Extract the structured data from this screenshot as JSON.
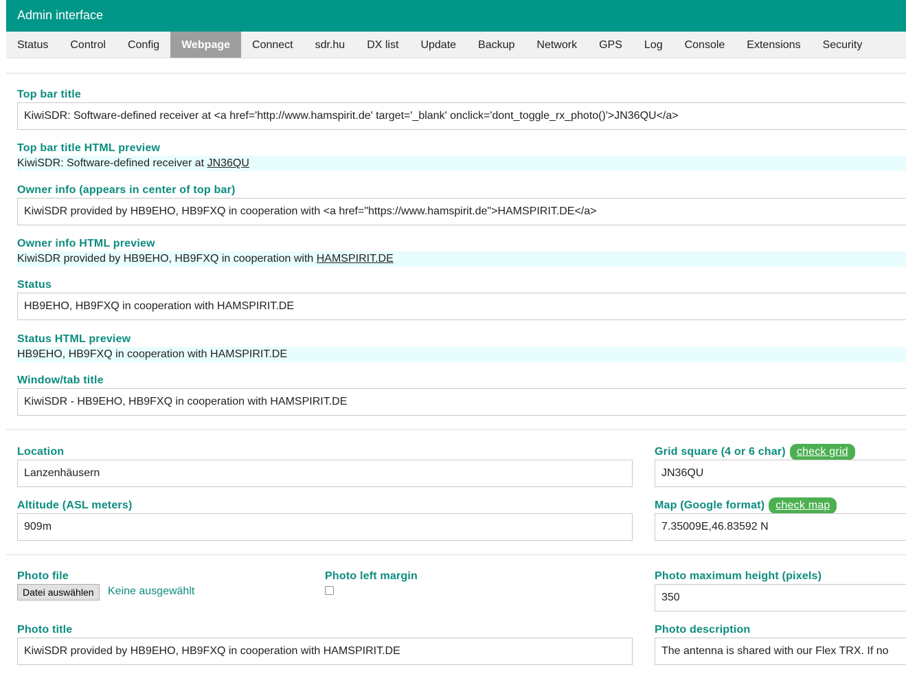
{
  "header": {
    "title": "Admin interface"
  },
  "tabs": [
    {
      "label": "Status"
    },
    {
      "label": "Control"
    },
    {
      "label": "Config"
    },
    {
      "label": "Webpage",
      "active": true
    },
    {
      "label": "Connect"
    },
    {
      "label": "sdr.hu"
    },
    {
      "label": "DX list"
    },
    {
      "label": "Update"
    },
    {
      "label": "Backup"
    },
    {
      "label": "Network"
    },
    {
      "label": "GPS"
    },
    {
      "label": "Log"
    },
    {
      "label": "Console"
    },
    {
      "label": "Extensions"
    },
    {
      "label": "Security"
    }
  ],
  "top_bar_title": {
    "label": "Top bar title",
    "value": "KiwiSDR: Software-defined receiver at <a href='http://www.hamspirit.de' target='_blank' onclick='dont_toggle_rx_photo()'>JN36QU</a>",
    "preview_label": "Top bar title HTML preview",
    "preview_text": "KiwiSDR: Software-defined receiver at ",
    "preview_link": "JN36QU"
  },
  "owner_info": {
    "label": "Owner info (appears in center of top bar)",
    "value": "KiwiSDR provided by HB9EHO, HB9FXQ in cooperation with <a href=\"https://www.hamspirit.de\">HAMSPIRIT.DE</a>",
    "preview_label": "Owner info HTML preview",
    "preview_text": "KiwiSDR provided by HB9EHO, HB9FXQ in cooperation with ",
    "preview_link": "HAMSPIRIT.DE"
  },
  "status": {
    "label": "Status",
    "value": "HB9EHO, HB9FXQ in cooperation with HAMSPIRIT.DE",
    "preview_label": "Status HTML preview",
    "preview_text": "HB9EHO, HB9FXQ in cooperation with HAMSPIRIT.DE"
  },
  "window_title": {
    "label": "Window/tab title",
    "value": "KiwiSDR - HB9EHO, HB9FXQ in cooperation with HAMSPIRIT.DE"
  },
  "location": {
    "label": "Location",
    "value": "Lanzenhäusern"
  },
  "grid": {
    "label": "Grid square (4 or 6 char)",
    "button": "check grid",
    "value": "JN36QU"
  },
  "altitude": {
    "label": "Altitude (ASL meters)",
    "value": "909m"
  },
  "map": {
    "label": "Map (Google format)",
    "button": "check map",
    "value": "7.35009E,46.83592 N"
  },
  "photo_file": {
    "label": "Photo file",
    "button": "Datei auswählen",
    "status": "Keine ausgewählt"
  },
  "photo_left_margin": {
    "label": "Photo left margin",
    "checked": false
  },
  "photo_max_height": {
    "label": "Photo maximum height (pixels)",
    "value": "350"
  },
  "photo_title": {
    "label": "Photo title",
    "value": "KiwiSDR provided by HB9EHO, HB9FXQ in cooperation with HAMSPIRIT.DE"
  },
  "photo_description": {
    "label": "Photo description",
    "value": "The antenna is shared with our Flex TRX. If no"
  },
  "colors": {
    "header_bg": "#009688",
    "label": "#0b8c7f",
    "active_tab": "#9e9e9e",
    "pill": "#4caf50",
    "preview_bg": "#e8fdfd"
  }
}
